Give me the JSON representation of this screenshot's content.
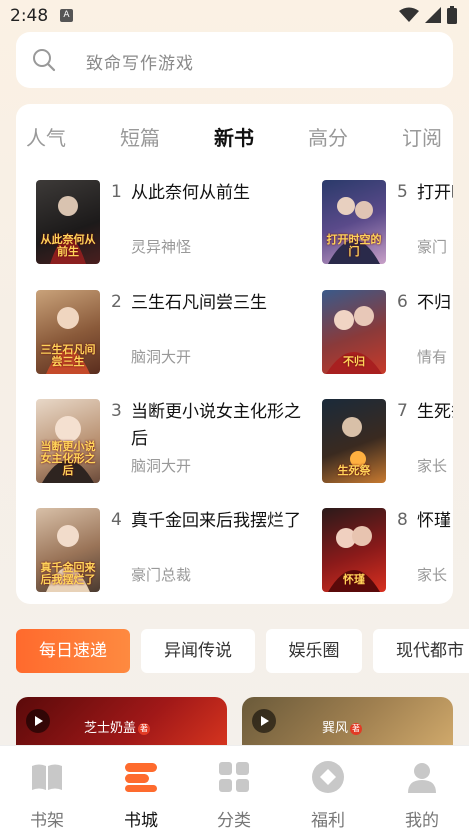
{
  "status": {
    "time": "2:48",
    "notif_letter": "A"
  },
  "search": {
    "placeholder": "致命写作游戏"
  },
  "tabs": [
    {
      "label": "人气",
      "active": false
    },
    {
      "label": "短篇",
      "active": false
    },
    {
      "label": "新书",
      "active": true
    },
    {
      "label": "高分",
      "active": false
    },
    {
      "label": "订阅",
      "active": false
    }
  ],
  "books": [
    {
      "rank": "1",
      "title": "从此奈何从前生",
      "tag": "灵异神怪",
      "cover_text": "从此奈何从前生"
    },
    {
      "rank": "2",
      "title": "三生石凡间尝三生",
      "tag": "脑洞大开",
      "cover_text": "三生石凡间尝三生"
    },
    {
      "rank": "3",
      "title": "当断更小说女主化形之后",
      "tag": "脑洞大开",
      "cover_text": "当断更小说女主化形之后"
    },
    {
      "rank": "4",
      "title": "真千金回来后我摆烂了",
      "tag": "豪门总裁",
      "cover_text": "真千金回来后我摆烂了"
    },
    {
      "rank": "5",
      "title": "打开时空的门",
      "tag": "豪门",
      "cover_text": "打开时空的门"
    },
    {
      "rank": "6",
      "title": "不归",
      "tag": "情有",
      "cover_text": "不归"
    },
    {
      "rank": "7",
      "title": "生死祭",
      "tag": "家长",
      "cover_text": "生死祭"
    },
    {
      "rank": "8",
      "title": "怀瑾",
      "tag": "家长",
      "cover_text": "怀瑾"
    }
  ],
  "chips": [
    {
      "label": "每日速递",
      "active": true
    },
    {
      "label": "异闻传说",
      "active": false
    },
    {
      "label": "娱乐圈",
      "active": false
    },
    {
      "label": "现代都市",
      "active": false
    }
  ],
  "banners": [
    {
      "author": "芝士奶盖",
      "badge": "著"
    },
    {
      "author": "巽风",
      "badge": "著"
    }
  ],
  "nav": [
    {
      "label": "书架",
      "icon": "book-icon",
      "active": false
    },
    {
      "label": "书城",
      "icon": "store-icon",
      "active": true
    },
    {
      "label": "分类",
      "icon": "grid-icon",
      "active": false
    },
    {
      "label": "福利",
      "icon": "gift-diamond-icon",
      "active": false
    },
    {
      "label": "我的",
      "icon": "user-icon",
      "active": false
    }
  ],
  "colors": {
    "accent": "#fe6b2e",
    "background": "#f8f1e8",
    "muted": "#999999"
  }
}
